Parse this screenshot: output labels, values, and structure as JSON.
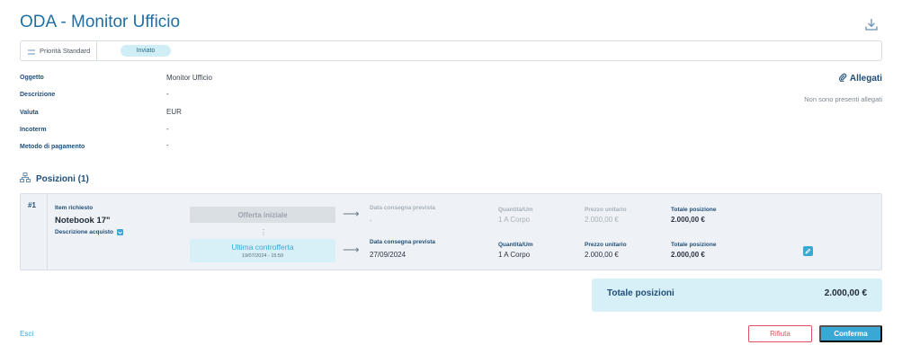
{
  "header": {
    "title": "ODA - Monitor Ufficio",
    "download_icon": "download-icon"
  },
  "priority": {
    "label": "Priorità Standard",
    "status": "Inviato"
  },
  "fields": [
    {
      "label": "Oggetto",
      "value": "Monitor Ufficio"
    },
    {
      "label": "Descrizione",
      "value": "-"
    },
    {
      "label": "Valuta",
      "value": "EUR"
    },
    {
      "label": "Incoterm",
      "value": "-"
    },
    {
      "label": "Metodo di pagamento",
      "value": "-"
    }
  ],
  "attachments": {
    "title": "Allegati",
    "empty_text": "Non sono presenti allegati"
  },
  "positions": {
    "title": "Posizioni (1)",
    "items": [
      {
        "number": "#1",
        "item_label": "Item richiesto",
        "item_name": "Notebook 17\"",
        "description_label": "Descrizione acquisto",
        "initial_offer": {
          "label": "Offerta iniziale",
          "delivery_label": "Data consegna prevista",
          "delivery_value": "-",
          "qty_label": "Quantità/Um",
          "qty_value": "1 A Corpo",
          "unit_price_label": "Prezzo unitario",
          "unit_price_value": "2.000,00 €",
          "total_label": "Totale posizione",
          "total_value": "2.000,00 €"
        },
        "counter_offer": {
          "label": "Ultima controfferta",
          "date": "19/07/2024 - 15:59",
          "delivery_label": "Data consegna prevista",
          "delivery_value": "27/09/2024",
          "qty_label": "Quantità/Um",
          "qty_value": "1 A Corpo",
          "unit_price_label": "Prezzo unitario",
          "unit_price_value": "2.000,00 €",
          "total_label": "Totale posizione",
          "total_value": "2.000,00 €"
        }
      }
    ]
  },
  "totals": {
    "label": "Totale posizioni",
    "value": "2.000,00 €"
  },
  "footer": {
    "exit_label": "Esci",
    "reject_label": "Rifiuta",
    "confirm_label": "Conferma"
  },
  "colors": {
    "accent": "#3aa8d4",
    "title": "#1f6fa5",
    "label": "#1f4e78",
    "danger": "#e0525f",
    "highlight_bg": "#d7f0f7"
  }
}
